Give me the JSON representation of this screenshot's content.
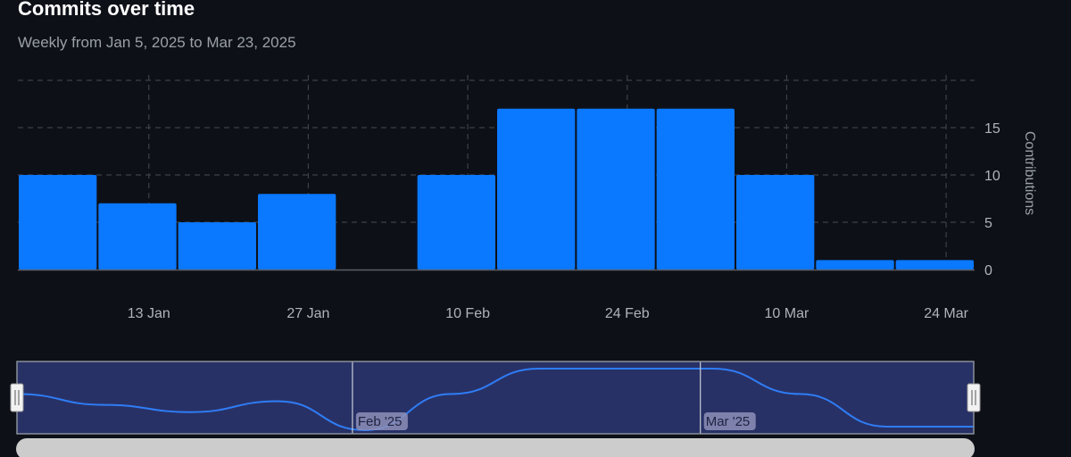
{
  "header": {
    "title": "Commits over time",
    "subtitle": "Weekly from Jan 5, 2025 to Mar 23, 2025"
  },
  "colors": {
    "background": "#0d1017",
    "bar": "#0a78ff",
    "grid": "#3c4048",
    "axis_text": "#b0b4ba",
    "navigator_fill": "#283166",
    "navigator_line": "#2f7df6",
    "navigator_outline": "#8a8f99",
    "scrollbar": "#cccccc"
  },
  "chart_data": {
    "type": "bar",
    "title": "Commits over time",
    "subtitle": "Weekly from Jan 5, 2025 to Mar 23, 2025",
    "x": [
      "2025-01-05",
      "2025-01-12",
      "2025-01-19",
      "2025-01-26",
      "2025-02-02",
      "2025-02-09",
      "2025-02-16",
      "2025-02-23",
      "2025-03-02",
      "2025-03-09",
      "2025-03-16",
      "2025-03-23"
    ],
    "values": [
      10,
      7,
      5,
      8,
      0,
      10,
      17,
      17,
      17,
      10,
      1,
      1
    ],
    "xlabel": "",
    "ylabel": "Contributions",
    "yticks": [
      0,
      5,
      10,
      15
    ],
    "xtick_labels": [
      "13 Jan",
      "27 Jan",
      "10 Feb",
      "24 Feb",
      "10 Mar",
      "24 Mar"
    ],
    "xtick_dates": [
      "2025-01-13",
      "2025-01-27",
      "2025-02-10",
      "2025-02-24",
      "2025-03-10",
      "2025-03-24"
    ],
    "ylim": [
      0,
      20
    ],
    "grid": true,
    "y_axis_side": "right",
    "legend": "none"
  },
  "navigator": {
    "labels": [
      "Feb '25",
      "Mar '25"
    ],
    "label_dates": [
      "2025-02-01",
      "2025-03-01"
    ]
  }
}
